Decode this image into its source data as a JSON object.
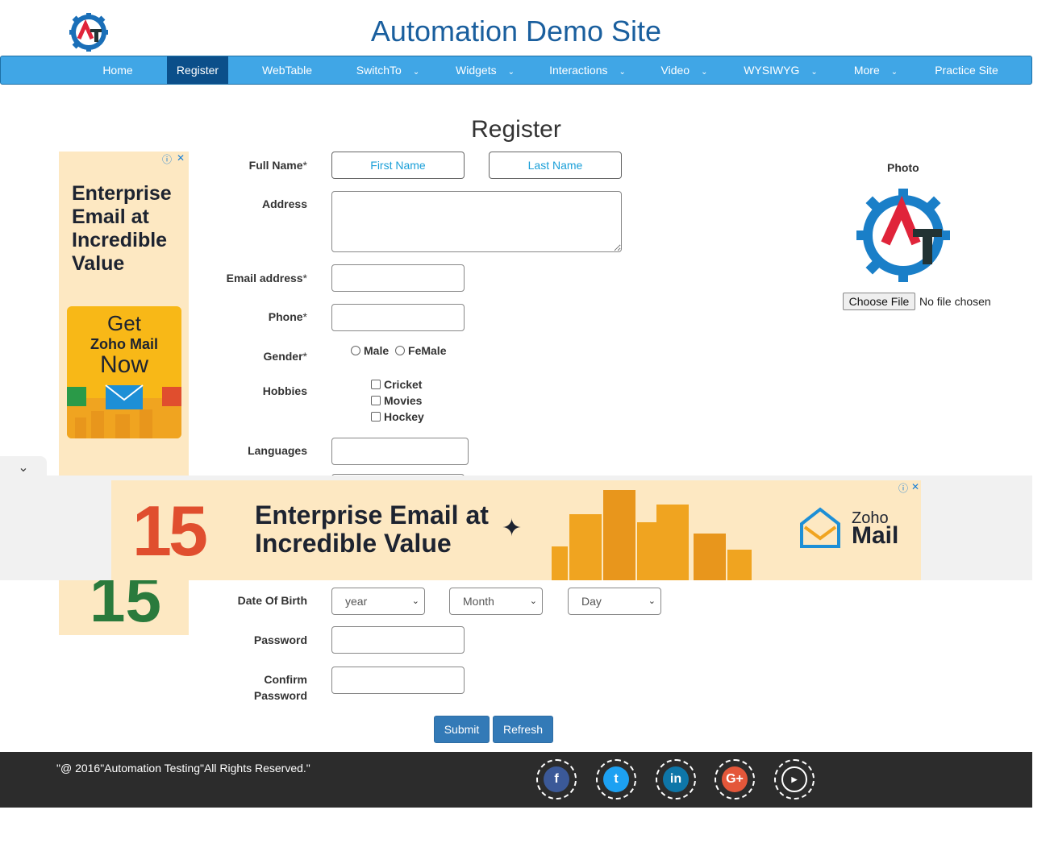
{
  "header": {
    "title": "Automation Demo Site"
  },
  "nav": {
    "items": [
      {
        "label": "Home"
      },
      {
        "label": "Register"
      },
      {
        "label": "WebTable"
      },
      {
        "label": "SwitchTo"
      },
      {
        "label": "Widgets"
      },
      {
        "label": "Interactions"
      },
      {
        "label": "Video"
      },
      {
        "label": "WYSIWYG"
      },
      {
        "label": "More"
      },
      {
        "label": "Practice Site"
      }
    ],
    "active": "Register",
    "caret": "⌄"
  },
  "form": {
    "heading": "Register",
    "full_name_label": "Full Name",
    "required_mark": "*",
    "first_name_placeholder": "First Name",
    "last_name_placeholder": "Last Name",
    "address_label": "Address",
    "email_label": "Email address",
    "phone_label": "Phone",
    "gender_label": "Gender",
    "gender_options": [
      "Male",
      "FeMale"
    ],
    "hobbies_label": "Hobbies",
    "hobbies": [
      "Cricket",
      "Movies",
      "Hockey"
    ],
    "languages_label": "Languages",
    "dob_label": "Date Of Birth",
    "dob_year": "year",
    "dob_month": "Month",
    "dob_day": "Day",
    "password_label": "Password",
    "confirm_password_label_1": "Confirm",
    "confirm_password_label_2": "Password",
    "submit_label": "Submit",
    "refresh_label": "Refresh"
  },
  "photo": {
    "label": "Photo",
    "choose_file": "Choose File",
    "no_file": "No file chosen"
  },
  "ads": {
    "left_headline_lines": [
      "Enterprise",
      "Email at",
      "Incredible",
      "Value"
    ],
    "left_cta_get": "Get",
    "left_cta_brand": "Zoho Mail",
    "left_cta_now": "Now",
    "left_number": "15",
    "banner_number": "15",
    "banner_text_line1": "Enterprise Email at",
    "banner_text_line2": "Incredible Value",
    "banner_brand_1": "Zoho",
    "banner_brand_2": "Mail",
    "info_icon": "ⓘ",
    "close_icon": "✕"
  },
  "footer": {
    "copyright": "\"@ 2016\"Automation Testing\"All Rights Reserved.\"",
    "social": [
      "facebook",
      "twitter",
      "linkedin",
      "google-plus",
      "youtube"
    ]
  },
  "colors": {
    "accent": "#40a6e6",
    "nav_active": "#0b4f8a",
    "title": "#1a5f9e",
    "button": "#337ab7",
    "footer_bg": "#2c2c2c"
  }
}
